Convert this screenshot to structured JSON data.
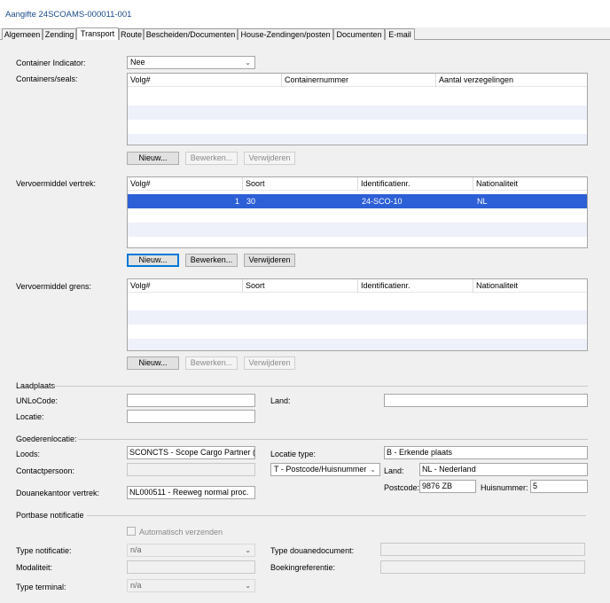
{
  "window_title": "Aangifte  24SCOAMS-000011-001",
  "tabs": [
    "Algemeen",
    "Zending",
    "Transport",
    "Route",
    "Bescheiden/Documenten",
    "House-Zendingen/posten",
    "Documenten",
    "E-mail"
  ],
  "active_tab": "Transport",
  "container_indicator": {
    "label": "Container Indicator:",
    "value": "Nee"
  },
  "containers": {
    "label": "Containers/seals:",
    "columns": [
      "Volg#",
      "Containernummer",
      "Aantal verzegelingen"
    ],
    "buttons": {
      "new": "Nieuw...",
      "edit": "Bewerken...",
      "delete": "Verwijderen"
    }
  },
  "vervoer_vertrek": {
    "label": "Vervoermiddel vertrek:",
    "columns": [
      "Volg#",
      "Soort",
      "Identificatienr.",
      "Nationaliteit"
    ],
    "rows": [
      {
        "volg": "1",
        "soort": "30",
        "id": "24-SCO-10",
        "nat": "NL"
      }
    ],
    "buttons": {
      "new": "Nieuw...",
      "edit": "Bewerken...",
      "delete": "Verwijderen"
    }
  },
  "vervoer_grens": {
    "label": "Vervoermiddel grens:",
    "columns": [
      "Volg#",
      "Soort",
      "Identificatienr.",
      "Nationaliteit"
    ],
    "buttons": {
      "new": "Nieuw...",
      "edit": "Bewerken...",
      "delete": "Verwijderen"
    }
  },
  "laadplaats": {
    "section": "Laadplaats",
    "unlocode_label": "UNLoCode:",
    "unlocode_value": "",
    "land_label": "Land:",
    "land_value": "",
    "locatie_label": "Locatie:",
    "locatie_value": ""
  },
  "goederenlocatie": {
    "section": "Goederenlocatie:",
    "loods_label": "Loods:",
    "loods_value": "SCONCTS - Scope Cargo Partner (for",
    "locatie_type_label": "Locatie type:",
    "locatie_type_value": "B - Erkende plaats",
    "contact_label": "Contactpersoon:",
    "contact_value": "",
    "postcode_type_value": "T - Postcode/Huisnummer",
    "land_label": "Land:",
    "land_value": "NL - Nederland",
    "douanekantoor_label": "Douanekantoor vertrek:",
    "douanekantoor_value": "NL000511 - Reeweg normal proc.",
    "postcode_label": "Postcode:",
    "postcode_value": "9876 ZB",
    "huisnummer_label": "Huisnummer:",
    "huisnummer_value": "5"
  },
  "portbase": {
    "section": "Portbase notificatie",
    "auto_send_label": "Automatisch verzenden",
    "type_notificatie_label": "Type notificatie:",
    "type_notificatie_value": "n/a",
    "type_douanedocument_label": "Type douanedocument:",
    "modaliteit_label": "Modaliteit:",
    "boekingreferentie_label": "Boekingreferentie:",
    "type_terminal_label": "Type terminal:",
    "type_terminal_value": "n/a"
  },
  "icons": {
    "dropdown": "chevron-down-icon"
  },
  "colors": {
    "selection": "#2d5fd6",
    "title": "#1a4a8a",
    "stripe": "#eef0fa"
  }
}
